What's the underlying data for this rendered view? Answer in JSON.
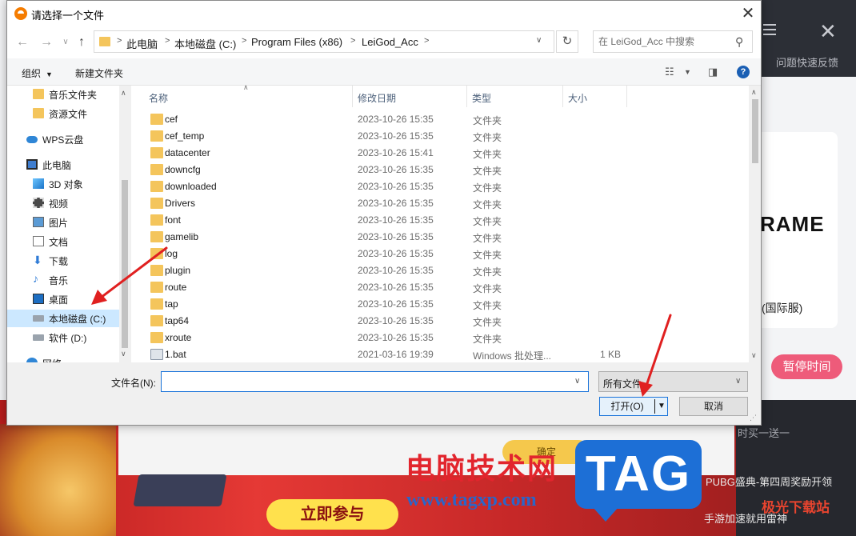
{
  "background_app": {
    "feedback": "问题快速反馈",
    "game_logo": "RAME",
    "game_server": "(国际服)",
    "pause_button": "暂停时间",
    "confirm_button": "确定",
    "join_button": "立即参与",
    "side_line_1": "次",
    "side_line_2": "时买一送一",
    "side_line_3": "PUBG盛典-第四周奖励开领",
    "side_line_4": "手游加速就用雷神"
  },
  "watermark": {
    "cn": "电脑技术网",
    "url": "www.tagxp.com",
    "tag": "TAG",
    "site": "极光下载站"
  },
  "dialog": {
    "title": "请选择一个文件",
    "breadcrumb": [
      "此电脑",
      "本地磁盘 (C:)",
      "Program Files (x86)",
      "LeiGod_Acc"
    ],
    "search_placeholder": "在 LeiGod_Acc 中搜索",
    "toolbar": {
      "organize": "组织",
      "new_folder": "新建文件夹"
    },
    "left_nav": [
      {
        "label": "音乐文件夹",
        "icon": "folder-icon"
      },
      {
        "label": "资源文件",
        "icon": "folder-icon"
      },
      {
        "label": "WPS云盘",
        "icon": "cloud-icon"
      },
      {
        "label": "此电脑",
        "icon": "computer-icon"
      },
      {
        "label": "3D 对象",
        "icon": "3d-objects-icon"
      },
      {
        "label": "视频",
        "icon": "video-icon"
      },
      {
        "label": "图片",
        "icon": "picture-icon"
      },
      {
        "label": "文档",
        "icon": "document-icon"
      },
      {
        "label": "下载",
        "icon": "download-icon"
      },
      {
        "label": "音乐",
        "icon": "music-icon"
      },
      {
        "label": "桌面",
        "icon": "desktop-icon"
      },
      {
        "label": "本地磁盘 (C:)",
        "icon": "drive-icon",
        "selected": true
      },
      {
        "label": "软件 (D:)",
        "icon": "drive-icon"
      },
      {
        "label": "网络",
        "icon": "network-icon"
      }
    ],
    "columns": {
      "name": "名称",
      "modified": "修改日期",
      "type": "类型",
      "size": "大小"
    },
    "files": [
      {
        "name": "cef",
        "modified": "2023-10-26 15:35",
        "type": "文件夹",
        "size": ""
      },
      {
        "name": "cef_temp",
        "modified": "2023-10-26 15:35",
        "type": "文件夹",
        "size": ""
      },
      {
        "name": "datacenter",
        "modified": "2023-10-26 15:41",
        "type": "文件夹",
        "size": ""
      },
      {
        "name": "downcfg",
        "modified": "2023-10-26 15:35",
        "type": "文件夹",
        "size": ""
      },
      {
        "name": "downloaded",
        "modified": "2023-10-26 15:35",
        "type": "文件夹",
        "size": ""
      },
      {
        "name": "Drivers",
        "modified": "2023-10-26 15:35",
        "type": "文件夹",
        "size": ""
      },
      {
        "name": "font",
        "modified": "2023-10-26 15:35",
        "type": "文件夹",
        "size": ""
      },
      {
        "name": "gamelib",
        "modified": "2023-10-26 15:35",
        "type": "文件夹",
        "size": ""
      },
      {
        "name": "log",
        "modified": "2023-10-26 15:35",
        "type": "文件夹",
        "size": ""
      },
      {
        "name": "plugin",
        "modified": "2023-10-26 15:35",
        "type": "文件夹",
        "size": ""
      },
      {
        "name": "route",
        "modified": "2023-10-26 15:35",
        "type": "文件夹",
        "size": ""
      },
      {
        "name": "tap",
        "modified": "2023-10-26 15:35",
        "type": "文件夹",
        "size": ""
      },
      {
        "name": "tap64",
        "modified": "2023-10-26 15:35",
        "type": "文件夹",
        "size": ""
      },
      {
        "name": "xroute",
        "modified": "2023-10-26 15:35",
        "type": "文件夹",
        "size": ""
      },
      {
        "name": "1.bat",
        "modified": "2021-03-16 19:39",
        "type": "Windows 批处理...",
        "size": "1 KB"
      }
    ],
    "filename_label": "文件名(N):",
    "filename_value": "",
    "filetype_value": "所有文件",
    "open_button": "打开(O)",
    "cancel_button": "取消"
  },
  "colors": {
    "accent": "#1a73d9",
    "selected": "#cce8ff",
    "arrow": "#e02020",
    "folder": "#f4c55c"
  }
}
